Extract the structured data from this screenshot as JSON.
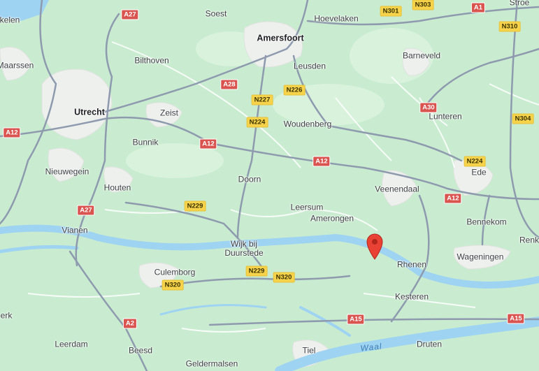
{
  "map": {
    "colors": {
      "land": "#c9ecd0",
      "urban": "#eef0ee",
      "road_major": "#8e9aae",
      "road_minor": "#ffffff",
      "water": "#9fd3f2",
      "motorway_shield": "#d9534f",
      "national_shield": "#f6d34a",
      "pin": "#e94235"
    },
    "places": {
      "utrecht": "Utrecht",
      "amersfoort": "Amersfoort",
      "soest": "Soest",
      "hoevelaken": "Hoevelaken",
      "stroe": "Stroe",
      "barneveld": "Barneveld",
      "maarssen": "Maarssen",
      "bilthoven": "Bilthoven",
      "leusden": "Leusden",
      "zeist": "Zeist",
      "woudenberg": "Woudenberg",
      "lunteren": "Lunteren",
      "bunnik": "Bunnik",
      "ede": "Ede",
      "nieuwegein": "Nieuwegein",
      "houten": "Houten",
      "doorn": "Doorn",
      "veenendaal": "Veenendaal",
      "leersum": "Leersum",
      "amerongen": "Amerongen",
      "bennekom": "Bennekom",
      "vianen": "Vianen",
      "renk": "Renk",
      "wijk_bij_duurstede": "Wijk bij\nDuurstede",
      "rhenen": "Rhenen",
      "wageningen": "Wageningen",
      "culemborg": "Culemborg",
      "kesteren": "Kesteren",
      "erk": "erk",
      "leerdam": "Leerdam",
      "beesd": "Beesd",
      "tiel": "Tiel",
      "druten": "Druten",
      "geldermalsen": "Geldermalsen",
      "kelen": "kelen"
    },
    "roads": {
      "a27_top": "A27",
      "n301": "N301",
      "n303": "N303",
      "a1": "A1",
      "n310": "N310",
      "a28": "A28",
      "n226": "N226",
      "n227": "N227",
      "a30": "A30",
      "a12_left": "A12",
      "n224_mid": "N224",
      "n304": "N304",
      "a12_mid": "A12",
      "a12_center": "A12",
      "n224_right": "N224",
      "a12_right": "A12",
      "n229_top": "N229",
      "a27_bottom": "A27",
      "n229_bottom": "N229",
      "n320_right": "N320",
      "n320_left": "N320",
      "a2": "A2",
      "a15_center": "A15",
      "a15_right": "A15"
    },
    "water_label": "Waal",
    "pin_icon": "location-pin-icon"
  }
}
